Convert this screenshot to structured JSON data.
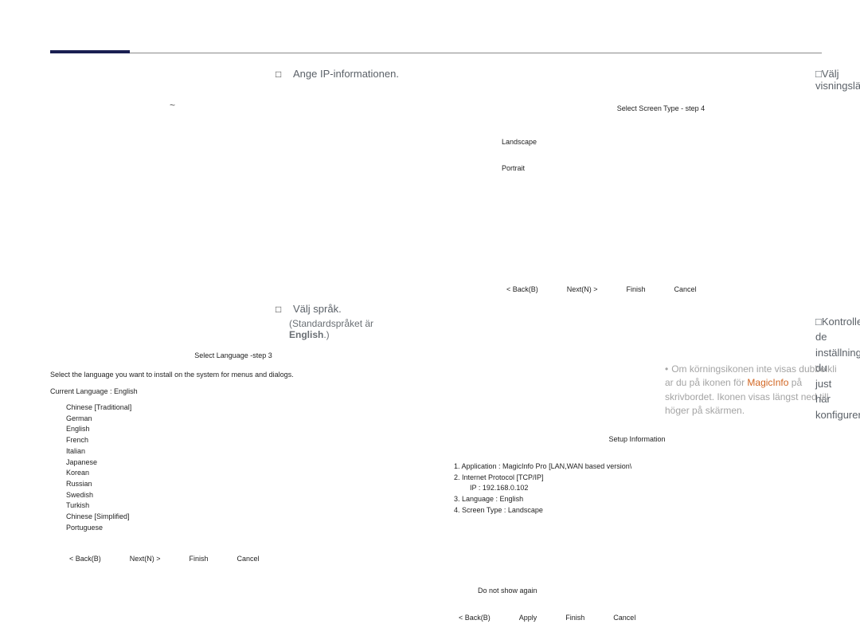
{
  "steps": {
    "ip_title": "Ange IP-informationen.",
    "display_title": "Välj visningsläge.",
    "lang_title": "Välj språk.",
    "lang_sub": "(Standardspråket är ",
    "lang_sub_bold": "English",
    "lang_sub_tail": ".)",
    "confirm_title": "Kontrollera de inställningar du just har konfigurerat."
  },
  "tilde": "~",
  "dlg_screen": {
    "title": "Select Screen Type - step 4",
    "opt1": "Landscape",
    "opt2": "Portrait",
    "btn_back": "< Back(B)",
    "btn_next": "Next(N) >",
    "btn_finish": "Finish",
    "btn_cancel": "Cancel"
  },
  "dlg_lang": {
    "title": "Select Language -step 3",
    "desc": "Select the language you want to install on the system for menus and dialogs.",
    "cur_label": "Current Language     :     English",
    "langs": [
      "Chinese [Traditional]",
      "German",
      "English",
      "French",
      "Italian",
      "Japanese",
      "Korean",
      "Russian",
      "Swedish",
      "Turkish",
      "Chinese [Simplified]",
      "Portuguese"
    ],
    "btn_back": "< Back(B)",
    "btn_next": "Next(N) >",
    "btn_finish": "Finish",
    "btn_cancel": "Cancel"
  },
  "dlg_setup": {
    "title": "Setup Information",
    "line1": "1. Application :      MagicInfo Pro [LAN,WAN based version\\",
    "line2": "2. Internet Protocol [TCP/IP]",
    "line2b": "IP :       192.168.0.102",
    "line3": "3. Language :      English",
    "line4": "4. Screen Type :     Landscape",
    "checkbox": "Do not show again",
    "btn_back": "< Back(B)",
    "btn_apply": "Apply",
    "btn_finish": "Finish",
    "btn_cancel": "Cancel"
  },
  "note": {
    "l1": "Om körningsikonen inte visas dubbelkli  ar du på ikonen för ",
    "magic": "MagicInfo",
    "l2": " på skrivbordet. Ikonen visas längst ned till höger på skärmen."
  }
}
